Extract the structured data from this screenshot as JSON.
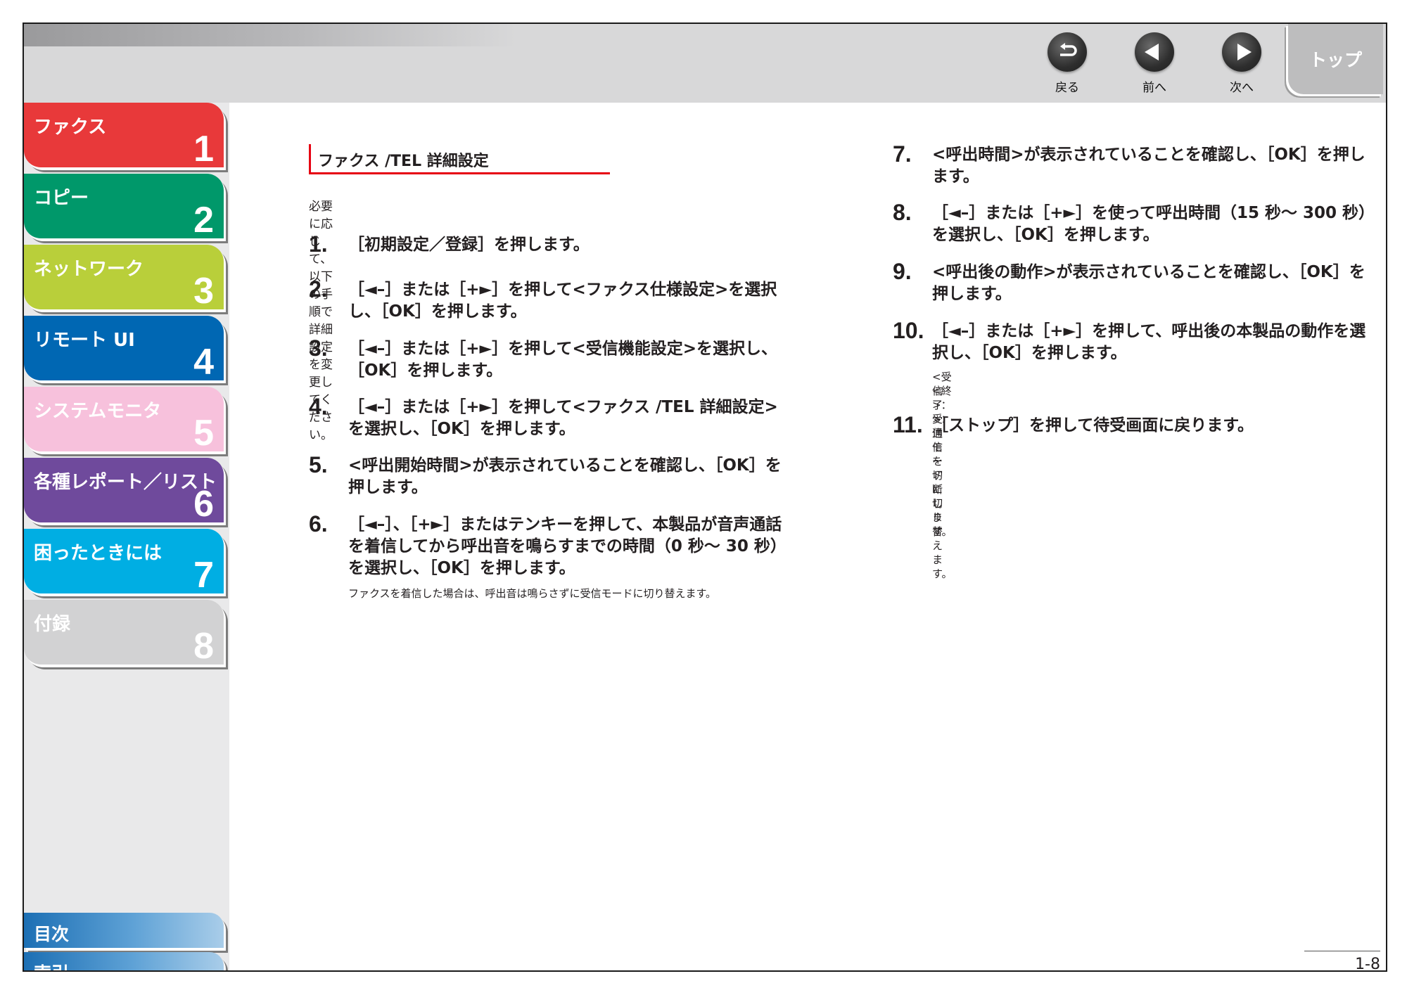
{
  "nav": {
    "back_label": "戻る",
    "prev_label": "前へ",
    "next_label": "次へ",
    "top_label": "トップ"
  },
  "sidebar": {
    "chapters": [
      {
        "title": "ファクス",
        "number": "1",
        "color": "#e8393a"
      },
      {
        "title": "コピー",
        "number": "2",
        "color": "#00986a"
      },
      {
        "title": "ネットワーク",
        "number": "3",
        "color": "#b9cf3a"
      },
      {
        "title": "リモート UI",
        "number": "4",
        "color": "#0067b3"
      },
      {
        "title": "システムモニタ",
        "number": "5",
        "color": "#f7c1dc"
      },
      {
        "title": "各種レポート／リスト",
        "number": "6",
        "color": "#6f4a9c"
      },
      {
        "title": "困ったときには",
        "number": "7",
        "color": "#00aee3"
      },
      {
        "title": "付録",
        "number": "8",
        "color": "#d2d2d3"
      }
    ],
    "toc_label": "目次",
    "index_label": "索引"
  },
  "content": {
    "section_title": "ファクス /TEL 詳細設定",
    "intro": "必要に応じて、以下の手順で詳細設定を変更してください。",
    "steps": [
      {
        "num": "1.",
        "text": "［初期設定／登録］を押します。"
      },
      {
        "num": "2.",
        "text": "［◄–］または［+►］を押して<ファクス仕様設定>を選択し、［OK］を押します。"
      },
      {
        "num": "3.",
        "text": "［◄–］または［+►］を押して<受信機能設定>を選択し、［OK］を押します。"
      },
      {
        "num": "4.",
        "text": "［◄–］または［+►］を押して<ファクス /TEL 詳細設定>を選択し、［OK］を押します。"
      },
      {
        "num": "5.",
        "text": "<呼出開始時間>が表示されていることを確認し、［OK］を押します。"
      },
      {
        "num": "6.",
        "text": "［◄–］、［+►］またはテンキーを押して、本製品が音声通話を着信してから呼出音を鳴らすまでの時間（0 秒～ 30 秒）を選択し、［OK］を押します。",
        "note": "ファクスを着信した場合は、呼出音は鳴らさずに受信モードに切り替えます。"
      },
      {
        "num": "7.",
        "text": "<呼出時間>が表示されていることを確認し、［OK］を押します。"
      },
      {
        "num": "8.",
        "text": "［◄–］または［+►］を使って呼出時間（15 秒～ 300 秒）を選択し、［OK］を押します。"
      },
      {
        "num": "9.",
        "text": "<呼出後の動作>が表示されていることを確認し、［OK］を押します。"
      },
      {
        "num": "10.",
        "text": "［◄–］または［+►］を押して、呼出後の本製品の動作を選択し、［OK］を押します。",
        "notes": [
          "<受信>：受信モードに切り替えます。",
          "<終了>：通信を切断します。"
        ]
      },
      {
        "num": "11.",
        "text": "［ストップ］を押して待受画面に戻ります。"
      }
    ]
  },
  "page_number": "1-8"
}
